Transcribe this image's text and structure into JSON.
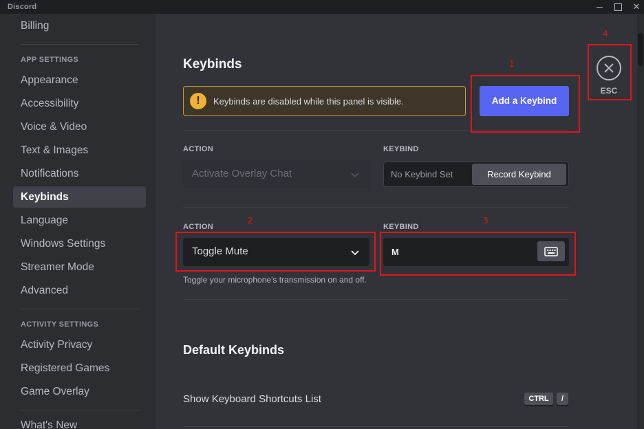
{
  "window": {
    "title": "Discord",
    "close_glyph": "✕"
  },
  "sidebar": {
    "items_top": [
      {
        "label": "Billing"
      }
    ],
    "app_settings_header": "APP SETTINGS",
    "app_settings_items": [
      {
        "label": "Appearance"
      },
      {
        "label": "Accessibility"
      },
      {
        "label": "Voice & Video"
      },
      {
        "label": "Text & Images"
      },
      {
        "label": "Notifications"
      },
      {
        "label": "Keybinds",
        "selected": true
      },
      {
        "label": "Language"
      },
      {
        "label": "Windows Settings"
      },
      {
        "label": "Streamer Mode"
      },
      {
        "label": "Advanced"
      }
    ],
    "activity_settings_header": "ACTIVITY SETTINGS",
    "activity_settings_items": [
      {
        "label": "Activity Privacy"
      },
      {
        "label": "Registered Games"
      },
      {
        "label": "Game Overlay"
      }
    ],
    "items_bottom": [
      {
        "label": "What's New"
      }
    ]
  },
  "main": {
    "title": "Keybinds",
    "warning": {
      "icon": "warning-icon",
      "glyph": "!",
      "text": "Keybinds are disabled while this panel is visible."
    },
    "add_button_label": "Add a Keybind",
    "keybind_rows": [
      {
        "action_label": "ACTION",
        "action_value": "Activate Overlay Chat",
        "disabled": true,
        "keybind_label": "KEYBIND",
        "keybind_placeholder": "No Keybind Set",
        "record_label": "Record Keybind"
      },
      {
        "action_label": "ACTION",
        "action_value": "Toggle Mute",
        "keybind_label": "KEYBIND",
        "keybind_value": "M",
        "description": "Toggle your microphone's transmission on and off."
      }
    ],
    "default_section_title": "Default Keybinds",
    "default_rows": [
      {
        "label": "Show Keyboard Shortcuts List",
        "keys": [
          "CTRL",
          "/"
        ]
      }
    ]
  },
  "close": {
    "label": "ESC",
    "icon": "close-icon"
  },
  "annotations": [
    {
      "number": "1",
      "target": "add-keybind-button"
    },
    {
      "number": "2",
      "target": "action-select"
    },
    {
      "number": "3",
      "target": "keybind-field"
    },
    {
      "number": "4",
      "target": "esc-close-button"
    }
  ],
  "colors": {
    "accent": "#5865f2",
    "warning": "#f0b232",
    "annotation": "#e3131b",
    "background": "#313338",
    "sidebar": "#2b2d31"
  }
}
